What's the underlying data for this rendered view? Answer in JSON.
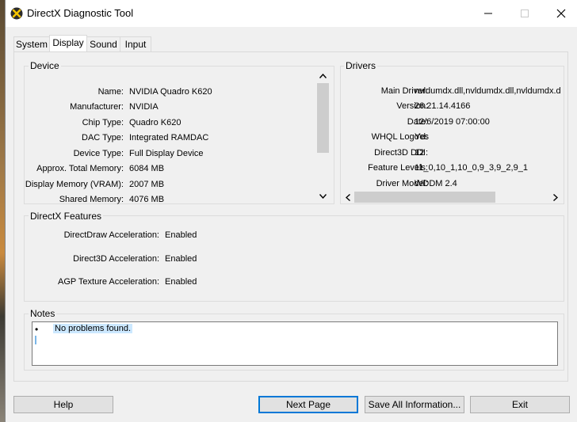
{
  "window": {
    "title": "DirectX Diagnostic Tool",
    "controls": {
      "minimize": "minimize",
      "maximize": "maximize",
      "close": "close"
    }
  },
  "tabs": [
    {
      "label": "System",
      "active": false
    },
    {
      "label": "Display",
      "active": true
    },
    {
      "label": "Sound",
      "active": false
    },
    {
      "label": "Input",
      "active": false
    }
  ],
  "device": {
    "title": "Device",
    "rows": [
      {
        "label": "Name:",
        "value": "NVIDIA Quadro K620"
      },
      {
        "label": "Manufacturer:",
        "value": "NVIDIA"
      },
      {
        "label": "Chip Type:",
        "value": "Quadro K620"
      },
      {
        "label": "DAC Type:",
        "value": "Integrated RAMDAC"
      },
      {
        "label": "Device Type:",
        "value": "Full Display Device"
      },
      {
        "label": "Approx. Total Memory:",
        "value": "6084 MB"
      },
      {
        "label": "Display Memory (VRAM):",
        "value": "2007 MB"
      },
      {
        "label": "Shared Memory:",
        "value": "4076 MB"
      }
    ]
  },
  "drivers": {
    "title": "Drivers",
    "rows": [
      {
        "label": "Main Driver:",
        "value": "nvldumdx.dll,nvldumdx.dll,nvldumdx.d"
      },
      {
        "label": "Version:",
        "value": "26.21.14.4166"
      },
      {
        "label": "Date:",
        "value": "12/6/2019 07:00:00"
      },
      {
        "label": "WHQL Logo'd:",
        "value": "Yes"
      },
      {
        "label": "Direct3D DDI:",
        "value": "12"
      },
      {
        "label": "Feature Levels:",
        "value": "11_0,10_1,10_0,9_3,9_2,9_1"
      },
      {
        "label": "Driver Model:",
        "value": "WDDM 2.4"
      }
    ]
  },
  "features": {
    "title": "DirectX Features",
    "rows": [
      {
        "label": "DirectDraw Acceleration:",
        "value": "Enabled"
      },
      {
        "label": "Direct3D Acceleration:",
        "value": "Enabled"
      },
      {
        "label": "AGP Texture Acceleration:",
        "value": "Enabled"
      }
    ]
  },
  "notes": {
    "title": "Notes",
    "items": [
      "No problems found."
    ],
    "bullet": "•"
  },
  "buttons": {
    "help": "Help",
    "next_page": "Next Page",
    "save_all": "Save All Information...",
    "exit": "Exit"
  },
  "colors": {
    "window_bg": "#f0f0f0",
    "accent": "#0078d7",
    "selection": "#cce8ff"
  }
}
